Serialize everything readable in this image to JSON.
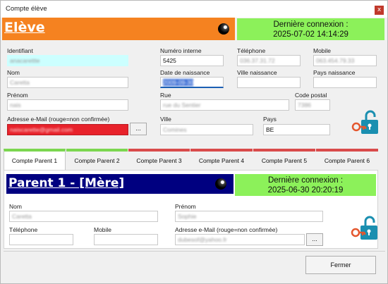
{
  "window": {
    "title": "Compte élève",
    "close_glyph": "x"
  },
  "eleve": {
    "banner_title": "Elève",
    "banner_color": "#f58220",
    "connection_label": "Dernière connexion :",
    "connection_date": "2025-07-02 14:14:29",
    "fields": {
      "identifiant": {
        "label": "Identifiant",
        "value": "anacarettte"
      },
      "numero_interne": {
        "label": "Numéro interne",
        "value": "5425"
      },
      "telephone": {
        "label": "Téléphone",
        "value": "036.37.31.72"
      },
      "mobile": {
        "label": "Mobile",
        "value": "063.454.79.33"
      },
      "nom": {
        "label": "Nom",
        "value": "Caretta"
      },
      "date_naissance": {
        "label": "Date de naissance",
        "value": "2009-09-30"
      },
      "ville_naissance": {
        "label": "Ville naissance",
        "value": ""
      },
      "pays_naissance": {
        "label": "Pays naissance",
        "value": ""
      },
      "prenom": {
        "label": "Prénom",
        "value": "nais"
      },
      "rue": {
        "label": "Rue",
        "value": "rue du Sentier"
      },
      "code_postal": {
        "label": "Code postal",
        "value": "7386"
      },
      "email": {
        "label": "Adresse e-Mail (rouge=non confirmée)",
        "value": "naiscarette@gmail.com"
      },
      "ville": {
        "label": "Ville",
        "value": "Comines"
      },
      "pays": {
        "label": "Pays",
        "value": "BE"
      }
    },
    "email_button": "...",
    "lock_icon": "lock-open-key-icon"
  },
  "tabs": [
    {
      "label": "Compte Parent 1",
      "indicator": "#7bd64f",
      "active": true
    },
    {
      "label": "Compte Parent 2",
      "indicator": "#7bd64f",
      "active": false
    },
    {
      "label": "Compte Parent 3",
      "indicator": "#d94b4b",
      "active": false
    },
    {
      "label": "Compte Parent 4",
      "indicator": "#d94b4b",
      "active": false
    },
    {
      "label": "Compte Parent 5",
      "indicator": "#d94b4b",
      "active": false
    },
    {
      "label": "Compte Parent 6",
      "indicator": "#d94b4b",
      "active": false
    }
  ],
  "parent": {
    "banner_title": "Parent 1 - [Mère]",
    "banner_color": "#000080",
    "connection_label": "Dernière connexion :",
    "connection_date": "2025-06-30 20:20:19",
    "fields": {
      "nom": {
        "label": "Nom",
        "value": "Caretta"
      },
      "prenom": {
        "label": "Prénom",
        "value": "Sophie"
      },
      "telephone": {
        "label": "Téléphone",
        "value": ""
      },
      "mobile": {
        "label": "Mobile",
        "value": ""
      },
      "email": {
        "label": "Adresse e-Mail (rouge=non confirmée)",
        "value": "dubesof@yahoo.fr"
      }
    },
    "email_button": "...",
    "lock_icon": "lock-open-key-icon"
  },
  "footer": {
    "close_button": "Fermer"
  },
  "colors": {
    "connection_bg": "#8cf15a",
    "email_unconfirmed": "#e8222b",
    "identifiant_bg": "#ccffff",
    "lock_color": "#1a8fb0",
    "key_color": "#e4572e"
  }
}
